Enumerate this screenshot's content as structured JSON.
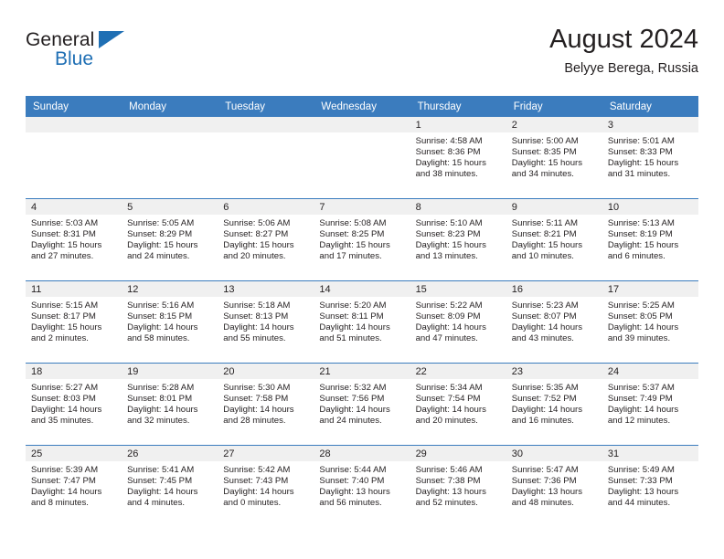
{
  "brand": {
    "name_top": "General",
    "name_bottom": "Blue",
    "triangle_color": "#1f6fb4"
  },
  "header": {
    "title": "August 2024",
    "subtitle": "Belyye Berega, Russia"
  },
  "theme": {
    "header_blue": "#3b7cbe",
    "daynum_band": "#f0f0f0",
    "text": "#231f20"
  },
  "weekday_headers": [
    "Sunday",
    "Monday",
    "Tuesday",
    "Wednesday",
    "Thursday",
    "Friday",
    "Saturday"
  ],
  "weeks": [
    [
      {
        "day": "",
        "empty": true,
        "sunrise": "",
        "sunset": "",
        "daylight1": "",
        "daylight2": ""
      },
      {
        "day": "",
        "empty": true,
        "sunrise": "",
        "sunset": "",
        "daylight1": "",
        "daylight2": ""
      },
      {
        "day": "",
        "empty": true,
        "sunrise": "",
        "sunset": "",
        "daylight1": "",
        "daylight2": ""
      },
      {
        "day": "",
        "empty": true,
        "sunrise": "",
        "sunset": "",
        "daylight1": "",
        "daylight2": ""
      },
      {
        "day": "1",
        "empty": false,
        "sunrise": "Sunrise: 4:58 AM",
        "sunset": "Sunset: 8:36 PM",
        "daylight1": "Daylight: 15 hours",
        "daylight2": "and 38 minutes."
      },
      {
        "day": "2",
        "empty": false,
        "sunrise": "Sunrise: 5:00 AM",
        "sunset": "Sunset: 8:35 PM",
        "daylight1": "Daylight: 15 hours",
        "daylight2": "and 34 minutes."
      },
      {
        "day": "3",
        "empty": false,
        "sunrise": "Sunrise: 5:01 AM",
        "sunset": "Sunset: 8:33 PM",
        "daylight1": "Daylight: 15 hours",
        "daylight2": "and 31 minutes."
      }
    ],
    [
      {
        "day": "4",
        "empty": false,
        "sunrise": "Sunrise: 5:03 AM",
        "sunset": "Sunset: 8:31 PM",
        "daylight1": "Daylight: 15 hours",
        "daylight2": "and 27 minutes."
      },
      {
        "day": "5",
        "empty": false,
        "sunrise": "Sunrise: 5:05 AM",
        "sunset": "Sunset: 8:29 PM",
        "daylight1": "Daylight: 15 hours",
        "daylight2": "and 24 minutes."
      },
      {
        "day": "6",
        "empty": false,
        "sunrise": "Sunrise: 5:06 AM",
        "sunset": "Sunset: 8:27 PM",
        "daylight1": "Daylight: 15 hours",
        "daylight2": "and 20 minutes."
      },
      {
        "day": "7",
        "empty": false,
        "sunrise": "Sunrise: 5:08 AM",
        "sunset": "Sunset: 8:25 PM",
        "daylight1": "Daylight: 15 hours",
        "daylight2": "and 17 minutes."
      },
      {
        "day": "8",
        "empty": false,
        "sunrise": "Sunrise: 5:10 AM",
        "sunset": "Sunset: 8:23 PM",
        "daylight1": "Daylight: 15 hours",
        "daylight2": "and 13 minutes."
      },
      {
        "day": "9",
        "empty": false,
        "sunrise": "Sunrise: 5:11 AM",
        "sunset": "Sunset: 8:21 PM",
        "daylight1": "Daylight: 15 hours",
        "daylight2": "and 10 minutes."
      },
      {
        "day": "10",
        "empty": false,
        "sunrise": "Sunrise: 5:13 AM",
        "sunset": "Sunset: 8:19 PM",
        "daylight1": "Daylight: 15 hours",
        "daylight2": "and 6 minutes."
      }
    ],
    [
      {
        "day": "11",
        "empty": false,
        "sunrise": "Sunrise: 5:15 AM",
        "sunset": "Sunset: 8:17 PM",
        "daylight1": "Daylight: 15 hours",
        "daylight2": "and 2 minutes."
      },
      {
        "day": "12",
        "empty": false,
        "sunrise": "Sunrise: 5:16 AM",
        "sunset": "Sunset: 8:15 PM",
        "daylight1": "Daylight: 14 hours",
        "daylight2": "and 58 minutes."
      },
      {
        "day": "13",
        "empty": false,
        "sunrise": "Sunrise: 5:18 AM",
        "sunset": "Sunset: 8:13 PM",
        "daylight1": "Daylight: 14 hours",
        "daylight2": "and 55 minutes."
      },
      {
        "day": "14",
        "empty": false,
        "sunrise": "Sunrise: 5:20 AM",
        "sunset": "Sunset: 8:11 PM",
        "daylight1": "Daylight: 14 hours",
        "daylight2": "and 51 minutes."
      },
      {
        "day": "15",
        "empty": false,
        "sunrise": "Sunrise: 5:22 AM",
        "sunset": "Sunset: 8:09 PM",
        "daylight1": "Daylight: 14 hours",
        "daylight2": "and 47 minutes."
      },
      {
        "day": "16",
        "empty": false,
        "sunrise": "Sunrise: 5:23 AM",
        "sunset": "Sunset: 8:07 PM",
        "daylight1": "Daylight: 14 hours",
        "daylight2": "and 43 minutes."
      },
      {
        "day": "17",
        "empty": false,
        "sunrise": "Sunrise: 5:25 AM",
        "sunset": "Sunset: 8:05 PM",
        "daylight1": "Daylight: 14 hours",
        "daylight2": "and 39 minutes."
      }
    ],
    [
      {
        "day": "18",
        "empty": false,
        "sunrise": "Sunrise: 5:27 AM",
        "sunset": "Sunset: 8:03 PM",
        "daylight1": "Daylight: 14 hours",
        "daylight2": "and 35 minutes."
      },
      {
        "day": "19",
        "empty": false,
        "sunrise": "Sunrise: 5:28 AM",
        "sunset": "Sunset: 8:01 PM",
        "daylight1": "Daylight: 14 hours",
        "daylight2": "and 32 minutes."
      },
      {
        "day": "20",
        "empty": false,
        "sunrise": "Sunrise: 5:30 AM",
        "sunset": "Sunset: 7:58 PM",
        "daylight1": "Daylight: 14 hours",
        "daylight2": "and 28 minutes."
      },
      {
        "day": "21",
        "empty": false,
        "sunrise": "Sunrise: 5:32 AM",
        "sunset": "Sunset: 7:56 PM",
        "daylight1": "Daylight: 14 hours",
        "daylight2": "and 24 minutes."
      },
      {
        "day": "22",
        "empty": false,
        "sunrise": "Sunrise: 5:34 AM",
        "sunset": "Sunset: 7:54 PM",
        "daylight1": "Daylight: 14 hours",
        "daylight2": "and 20 minutes."
      },
      {
        "day": "23",
        "empty": false,
        "sunrise": "Sunrise: 5:35 AM",
        "sunset": "Sunset: 7:52 PM",
        "daylight1": "Daylight: 14 hours",
        "daylight2": "and 16 minutes."
      },
      {
        "day": "24",
        "empty": false,
        "sunrise": "Sunrise: 5:37 AM",
        "sunset": "Sunset: 7:49 PM",
        "daylight1": "Daylight: 14 hours",
        "daylight2": "and 12 minutes."
      }
    ],
    [
      {
        "day": "25",
        "empty": false,
        "sunrise": "Sunrise: 5:39 AM",
        "sunset": "Sunset: 7:47 PM",
        "daylight1": "Daylight: 14 hours",
        "daylight2": "and 8 minutes."
      },
      {
        "day": "26",
        "empty": false,
        "sunrise": "Sunrise: 5:41 AM",
        "sunset": "Sunset: 7:45 PM",
        "daylight1": "Daylight: 14 hours",
        "daylight2": "and 4 minutes."
      },
      {
        "day": "27",
        "empty": false,
        "sunrise": "Sunrise: 5:42 AM",
        "sunset": "Sunset: 7:43 PM",
        "daylight1": "Daylight: 14 hours",
        "daylight2": "and 0 minutes."
      },
      {
        "day": "28",
        "empty": false,
        "sunrise": "Sunrise: 5:44 AM",
        "sunset": "Sunset: 7:40 PM",
        "daylight1": "Daylight: 13 hours",
        "daylight2": "and 56 minutes."
      },
      {
        "day": "29",
        "empty": false,
        "sunrise": "Sunrise: 5:46 AM",
        "sunset": "Sunset: 7:38 PM",
        "daylight1": "Daylight: 13 hours",
        "daylight2": "and 52 minutes."
      },
      {
        "day": "30",
        "empty": false,
        "sunrise": "Sunrise: 5:47 AM",
        "sunset": "Sunset: 7:36 PM",
        "daylight1": "Daylight: 13 hours",
        "daylight2": "and 48 minutes."
      },
      {
        "day": "31",
        "empty": false,
        "sunrise": "Sunrise: 5:49 AM",
        "sunset": "Sunset: 7:33 PM",
        "daylight1": "Daylight: 13 hours",
        "daylight2": "and 44 minutes."
      }
    ]
  ]
}
